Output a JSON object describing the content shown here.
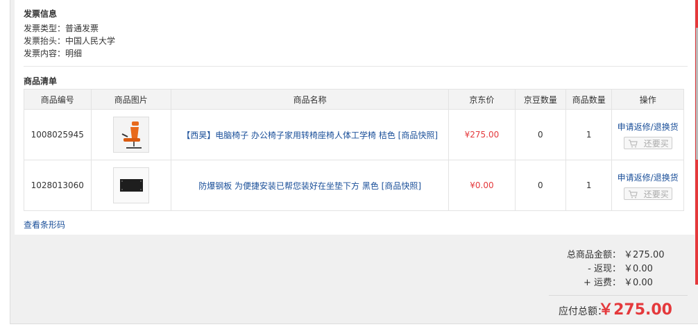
{
  "invoice": {
    "title": "发票信息",
    "rows": [
      {
        "label": "发票类型：",
        "value": "普通发票"
      },
      {
        "label": "发票抬头：",
        "value": "中国人民大学"
      },
      {
        "label": "发票内容：",
        "value": "明细"
      }
    ]
  },
  "goods": {
    "title": "商品清单",
    "headers": [
      "商品编号",
      "商品图片",
      "商品名称",
      "京东价",
      "京豆数量",
      "商品数量",
      "操作"
    ],
    "rows": [
      {
        "id": "1008025945",
        "thumb": "orange-office-chair",
        "name": "【西昊】电脑椅子 办公椅子家用转椅座椅人体工学椅 桔色 [商品快照]",
        "price": "¥275.00",
        "beans": "0",
        "qty": "1",
        "op_link": "申请返修/退换货",
        "rebuy": "还要买"
      },
      {
        "id": "1028013060",
        "thumb": "black-steel-plate",
        "name": "防爆钢板 为便捷安装已帮您装好在坐垫下方 黑色 [商品快照]",
        "price": "¥0.00",
        "beans": "0",
        "qty": "1",
        "op_link": "申请返修/退换货",
        "rebuy": "还要买"
      }
    ],
    "barcode_link": "查看条形码"
  },
  "summary": {
    "items_total_label": "总商品金额：",
    "items_total": "￥275.00",
    "cashback_label": "- 返现：",
    "cashback": "￥0.00",
    "shipping_label": "+ 运费：",
    "shipping": "￥0.00",
    "payable_label": "应付总额：",
    "payable": "￥275.00"
  },
  "colors": {
    "price": "#e4393c",
    "link": "#1a4f99",
    "accent": "#e4393c"
  }
}
